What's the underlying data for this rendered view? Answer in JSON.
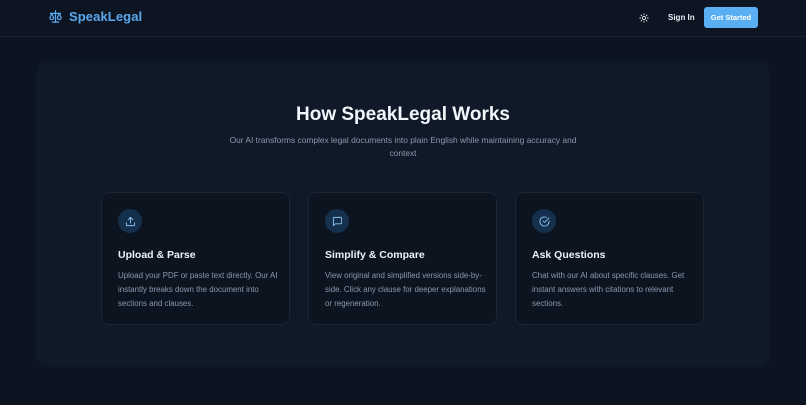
{
  "header": {
    "brand_name": "SpeakLegal",
    "brand_icon": "scale-icon",
    "theme_icon": "sun-icon",
    "sign_in_label": "Sign In",
    "cta_label": "Get Started"
  },
  "how_it_works": {
    "title": "How SpeakLegal Works",
    "subtitle": "Our AI transforms complex legal documents into plain English while maintaining accuracy and context",
    "cards": [
      {
        "icon": "upload-icon",
        "title": "Upload & Parse",
        "description": "Upload your PDF or paste text directly. Our AI instantly breaks down the document into sections and clauses."
      },
      {
        "icon": "message-square-icon",
        "title": "Simplify & Compare",
        "description": "View original and simplified versions side-by-side. Click any clause for deeper explanations or regeneration."
      },
      {
        "icon": "check-circle-icon",
        "title": "Ask Questions",
        "description": "Chat with our AI about specific clauses. Get instant answers with citations to relevant sections."
      }
    ]
  },
  "colors": {
    "background": "#0c1421",
    "accent": "#5aaff2",
    "brand": "#5aa9ee",
    "card_background": "#0c1420",
    "icon_circle": "#15304c"
  }
}
